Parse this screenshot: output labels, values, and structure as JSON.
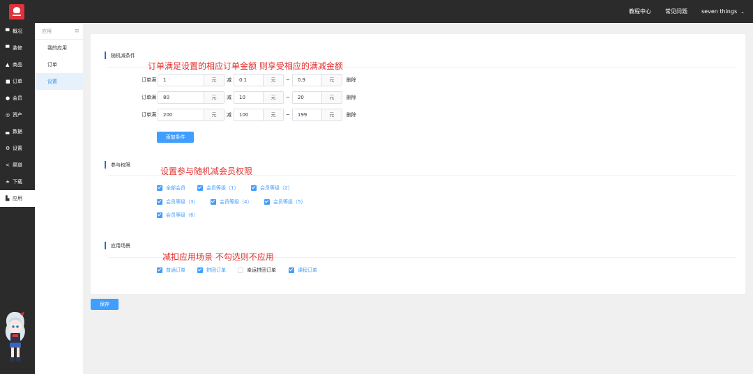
{
  "header": {
    "links": [
      "教程中心",
      "常见问题"
    ],
    "user": "seven things"
  },
  "sidebar": {
    "items": [
      {
        "label": "概况",
        "icon": "monitor-icon"
      },
      {
        "label": "装修",
        "icon": "monitor-icon"
      },
      {
        "label": "商品",
        "icon": "bag-icon"
      },
      {
        "label": "订单",
        "icon": "document-icon"
      },
      {
        "label": "会员",
        "icon": "user-icon"
      },
      {
        "label": "资产",
        "icon": "coin-icon"
      },
      {
        "label": "数据",
        "icon": "bar-chart-icon"
      },
      {
        "label": "设置",
        "icon": "gear-icon"
      },
      {
        "label": "渠道",
        "icon": "share-icon"
      },
      {
        "label": "下载",
        "icon": "download-icon"
      },
      {
        "label": "应用",
        "icon": "app-icon"
      }
    ],
    "active_index": 10
  },
  "subnav": {
    "title": "应用",
    "items": [
      "我的应用",
      "订单",
      "设置"
    ],
    "active_index": 2
  },
  "section_random_reduce": {
    "title": "随机减条件",
    "annotation": "订单满足设置的相应订单金额 则享受相应的满减金额",
    "row_label": "订单满",
    "unit": "元",
    "reduce_word": "减",
    "range_sep": "~",
    "delete_label": "删除",
    "rows": [
      {
        "order_amount": "1",
        "min_reduce": "0.1",
        "max_reduce": "0.9"
      },
      {
        "order_amount": "80",
        "min_reduce": "10",
        "max_reduce": "20"
      },
      {
        "order_amount": "200",
        "min_reduce": "100",
        "max_reduce": "199"
      }
    ],
    "add_button": "添加条件"
  },
  "section_permission": {
    "title": "参与权限",
    "annotation": "设置参与随机减会员权限",
    "options": [
      {
        "label": "全部会员",
        "checked": true
      },
      {
        "label": "会员等级（1）",
        "checked": true
      },
      {
        "label": "会员等级（2）",
        "checked": true
      },
      {
        "label": "会员等级（3）",
        "checked": true
      },
      {
        "label": "会员等级（4）",
        "checked": true
      },
      {
        "label": "会员等级（5）",
        "checked": true
      },
      {
        "label": "会员等级（6）",
        "checked": true
      }
    ]
  },
  "section_scene": {
    "title": "应用场景",
    "annotation": "减扣应用场景 不勾选则不应用",
    "options": [
      {
        "label": "普通订单",
        "checked": true
      },
      {
        "label": "拼团订单",
        "checked": true
      },
      {
        "label": "幸运拼团订单",
        "checked": false
      },
      {
        "label": "课程订单",
        "checked": true
      }
    ]
  },
  "save_button": "保存",
  "colors": {
    "accent": "#409eff",
    "annotation": "#e52f2f",
    "topbar": "#2b2b2b"
  }
}
